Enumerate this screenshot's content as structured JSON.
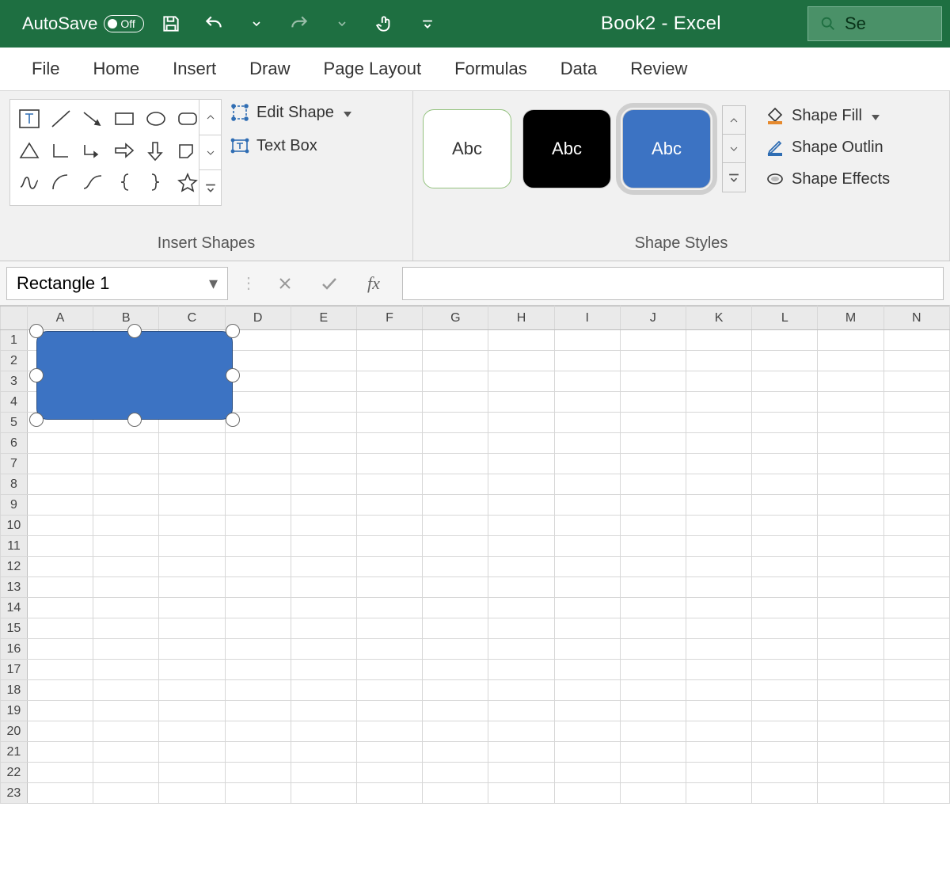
{
  "titlebar": {
    "autosave_label": "AutoSave",
    "autosave_state": "Off",
    "document_title": "Book2  -  Excel",
    "search_placeholder": "Se"
  },
  "tabs": [
    "File",
    "Home",
    "Insert",
    "Draw",
    "Page Layout",
    "Formulas",
    "Data",
    "Review"
  ],
  "ribbon": {
    "insert_shapes": {
      "label": "Insert Shapes",
      "edit_shape": "Edit Shape",
      "text_box": "Text Box"
    },
    "shape_styles": {
      "label": "Shape Styles",
      "preview_text": "Abc",
      "fill": "Shape Fill",
      "outline": "Shape Outlin",
      "effects": "Shape Effects"
    }
  },
  "formula_bar": {
    "name_box": "Rectangle 1",
    "fx_label": "fx",
    "formula": ""
  },
  "grid": {
    "columns": [
      "A",
      "B",
      "C",
      "D",
      "E",
      "F",
      "G",
      "H",
      "I",
      "J",
      "K",
      "L",
      "M",
      "N"
    ],
    "row_count": 23
  },
  "shape": {
    "name": "Rectangle 1",
    "fill_color": "#3c73c3"
  }
}
